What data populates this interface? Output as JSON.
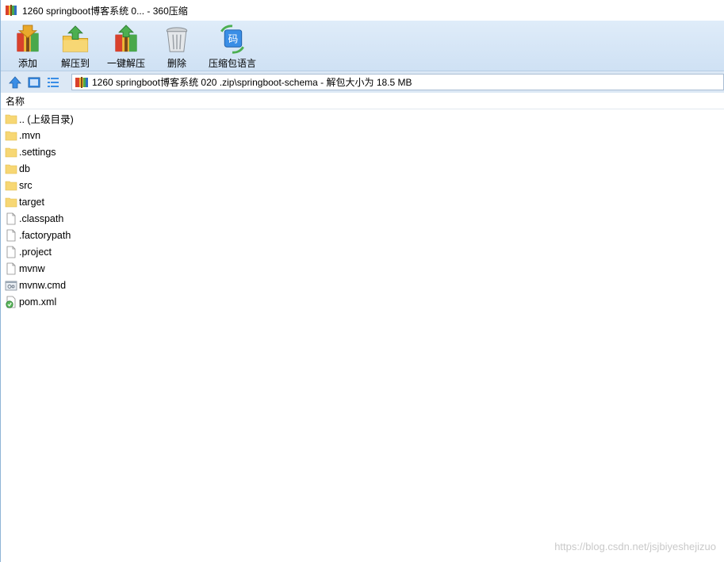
{
  "window": {
    "title": "1260 springboot博客系统 0... - 360压缩"
  },
  "toolbar": {
    "items": [
      {
        "label": "添加",
        "icon": "add-archive-icon"
      },
      {
        "label": "解压到",
        "icon": "extract-to-icon"
      },
      {
        "label": "一键解压",
        "icon": "one-click-extract-icon"
      },
      {
        "label": "删除",
        "icon": "delete-trash-icon"
      },
      {
        "label": "压缩包语言",
        "icon": "archive-language-icon"
      }
    ]
  },
  "navigation": {
    "up_icon": "up-arrow-icon",
    "thumbnail_view_icon": "thumbnail-view-icon",
    "list_view_icon": "list-view-icon"
  },
  "address": {
    "path": "1260 springboot博客系统 020 .zip\\springboot-schema - 解包大小为 18.5 MB"
  },
  "list": {
    "column_name": "名称",
    "files": [
      {
        "name": ".. (上级目录)",
        "type": "folder"
      },
      {
        "name": ".mvn",
        "type": "folder"
      },
      {
        "name": ".settings",
        "type": "folder"
      },
      {
        "name": "db",
        "type": "folder"
      },
      {
        "name": "src",
        "type": "folder"
      },
      {
        "name": "target",
        "type": "folder"
      },
      {
        "name": ".classpath",
        "type": "file"
      },
      {
        "name": ".factorypath",
        "type": "file"
      },
      {
        "name": ".project",
        "type": "file"
      },
      {
        "name": "mvnw",
        "type": "file"
      },
      {
        "name": "mvnw.cmd",
        "type": "cmd"
      },
      {
        "name": "pom.xml",
        "type": "xml"
      }
    ]
  },
  "watermark": "https://blog.csdn.net/jsjbiyeshejizuo",
  "colors": {
    "toolbar_bg": "#dfecf9",
    "folder_yellow": "#f7d774",
    "accent_blue": "#3a8ee6"
  }
}
